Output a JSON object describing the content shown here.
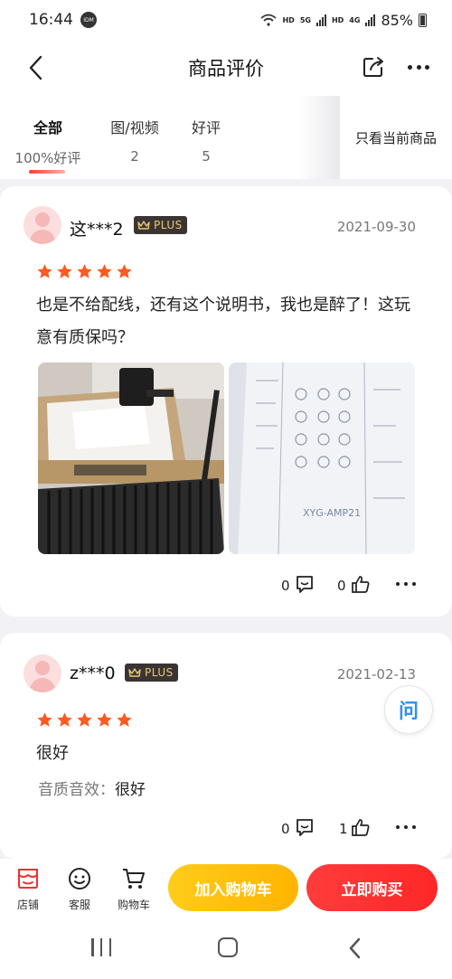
{
  "status_bar": {
    "time": "16:44",
    "idm": "IDM",
    "net1": "HD",
    "net2": "5G",
    "net3": "HD",
    "net4": "4G",
    "battery": "85%"
  },
  "header": {
    "title": "商品评价"
  },
  "tabs": [
    {
      "label": "全部",
      "sub": "100%好评"
    },
    {
      "label": "图/视频",
      "sub": "2"
    },
    {
      "label": "好评",
      "sub": "5"
    }
  ],
  "only_current_label": "只看当前商品",
  "reviews": [
    {
      "user": "这***2",
      "badge": "PLUS",
      "date": "2021-09-30",
      "rating": 5,
      "text": "也是不给配线，还有这个说明书，我也是醉了！这玩意有质保吗？",
      "photo_text": "XYG-AMP21",
      "comments": "0",
      "likes": "0"
    },
    {
      "user": "z***0",
      "badge": "PLUS",
      "date": "2021-02-13",
      "rating": 5,
      "text": "很好",
      "attr_key": "音质音效：",
      "attr_value": "很好",
      "comments": "0",
      "likes": "1"
    }
  ],
  "ask_label": "问",
  "bottom_bar": {
    "shop": "店铺",
    "service": "客服",
    "cart": "购物车",
    "add_to_cart": "加入购物车",
    "buy_now": "立即购买"
  },
  "colors": {
    "accent_red": "#ff2727",
    "accent_yellow": "#ffb400",
    "star_orange": "#ff5a1f",
    "plus_gold": "#e9c77b"
  }
}
